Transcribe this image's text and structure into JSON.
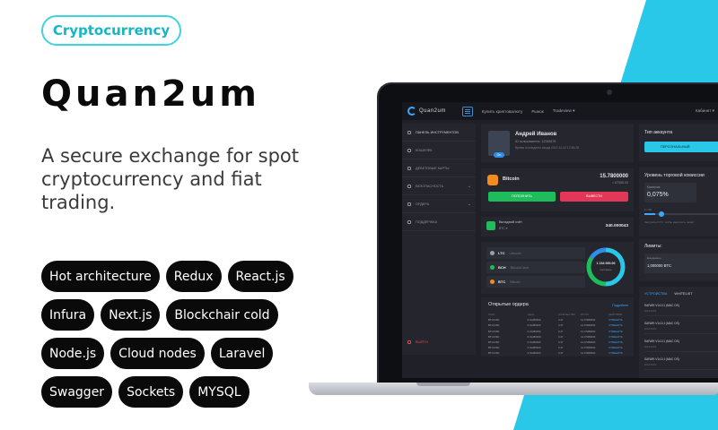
{
  "colors": {
    "accent": "#29c8e8",
    "brand_dark": "#0a0a0a",
    "buy": "#1ebc5a",
    "sell": "#e33758",
    "link": "#3fa6ff"
  },
  "hero": {
    "badge": "Cryptocurrency",
    "title": "Quan2um",
    "tagline": "A secure exchange for spot cryptocurrency and fiat trading."
  },
  "tech_tags": [
    [
      "Hot architecture",
      "Redux",
      "React.js"
    ],
    [
      "Infura",
      "Next.js",
      "Blockchair cold"
    ],
    [
      "Node.js",
      "Cloud nodes",
      "Laravel"
    ],
    [
      "Swagger",
      "Sockets",
      "MYSQL"
    ]
  ],
  "app": {
    "logo_text": "Quan2um",
    "nav": [
      "Купить криптовалюту",
      "Рынок",
      "Tradeview ▾"
    ],
    "cabinet": "Кабинет ▾",
    "sidebar": [
      {
        "label": "ПАНЕЛЬ ИНСТРУМЕНТОВ",
        "icon": "grid-icon"
      },
      {
        "label": "КОШЕЛЁК",
        "icon": "wallet-icon"
      },
      {
        "label": "ДЕБЕТОВЫЕ КАРТЫ",
        "icon": "card-icon"
      },
      {
        "label": "БЕЗОПАСНОСТЬ",
        "icon": "shield-icon"
      },
      {
        "label": "ОРДЕРА",
        "icon": "orders-icon"
      },
      {
        "label": "ПОДДЕРЖКА",
        "icon": "headset-icon"
      }
    ],
    "exit": "ВЫЙТИ",
    "profile": {
      "name": "Андрей Иванов",
      "id": "ID пользователя: 12345678",
      "last_login": "Время последнего входа 2022.11.02 12:45:28",
      "status": "On"
    },
    "bitcoin": {
      "name": "Bitcoin",
      "amount": "15.7800000",
      "fiat": "≈ 67350.00",
      "buy": "ПОПОЛНИТЬ",
      "sell": "ВЫВЕСТИ"
    },
    "deposit": {
      "label": "Вкладной счёт",
      "sub": "BTC ▾",
      "value": "340.000043"
    },
    "assets": [
      {
        "code": "LTC",
        "name": "Litecoin",
        "color": "#9aa0aa"
      },
      {
        "code": "BCH",
        "name": "BitcoinCash",
        "color": "#1ebc5a"
      },
      {
        "code": "BTC",
        "name": "Bitcoin",
        "color": "#f58a1f"
      }
    ],
    "portfolio": {
      "value": "1 234 000.00",
      "sub": "портфель"
    },
    "orders": {
      "title": "Открытые ордера",
      "link": "Подробнее",
      "headers": [
        "ПАРА",
        "ЦЕНА",
        "КОЛИЧЕСТВО",
        "ИТОГО",
        "ДЕЙСТВИЕ"
      ],
      "rows": [
        [
          "BTC/USD",
          "0.01280000",
          "0.47",
          "14.07380000",
          "ОТМЕНИТЬ"
        ],
        [
          "BTC/USD",
          "0.01280000",
          "0.47",
          "14.07380000",
          "ОТМЕНИТЬ"
        ],
        [
          "BTC/USD",
          "0.01280000",
          "0.47",
          "14.07380000",
          "ОТМЕНИТЬ"
        ],
        [
          "BTC/USD",
          "0.01280000",
          "0.47",
          "14.07380000",
          "ОТМЕНИТЬ"
        ],
        [
          "BTC/USD",
          "0.01280000",
          "0.47",
          "14.07380000",
          "ОТМЕНИТЬ"
        ],
        [
          "BTC/USD",
          "0.01280000",
          "0.47",
          "14.07380000",
          "ОТМЕНИТЬ"
        ],
        [
          "BTC/USD",
          "0.01280000",
          "0.47",
          "14.07380000",
          "ОТМЕНИТЬ"
        ]
      ]
    },
    "account": {
      "title": "Тип аккаунта",
      "button": "ПЕРСОНАЛЬНЫЙ"
    },
    "fee": {
      "title": "Уровень торговой комиссии",
      "label": "Комиссия",
      "value": "0,075%",
      "range": "1 / 10",
      "level_fraction": 0.1,
      "note": "Загрузите KYC, чтобы увеличить лимит"
    },
    "limits": {
      "title": "Лимиты:",
      "label": "Ежедневно",
      "value": "1,000000 BTC"
    },
    "devices": {
      "tab_active": "УСТРОЙСТВА",
      "tab_other": "WHITELIST",
      "items": [
        {
          "name": "SAFARI V14.0.1 (MAC OS)",
          "ip": "0.0.0.0.0.0"
        },
        {
          "name": "SAFARI V14.0.1 (MAC OS)",
          "ip": "0.0.0.0.0.0"
        },
        {
          "name": "SAFARI V14.0.1 (MAC OS)",
          "ip": "0.0.0.0.0.0"
        },
        {
          "name": "SAFARI V14.0.1 (MAC OS)",
          "ip": "0.0.0.0.0.0"
        }
      ]
    }
  }
}
